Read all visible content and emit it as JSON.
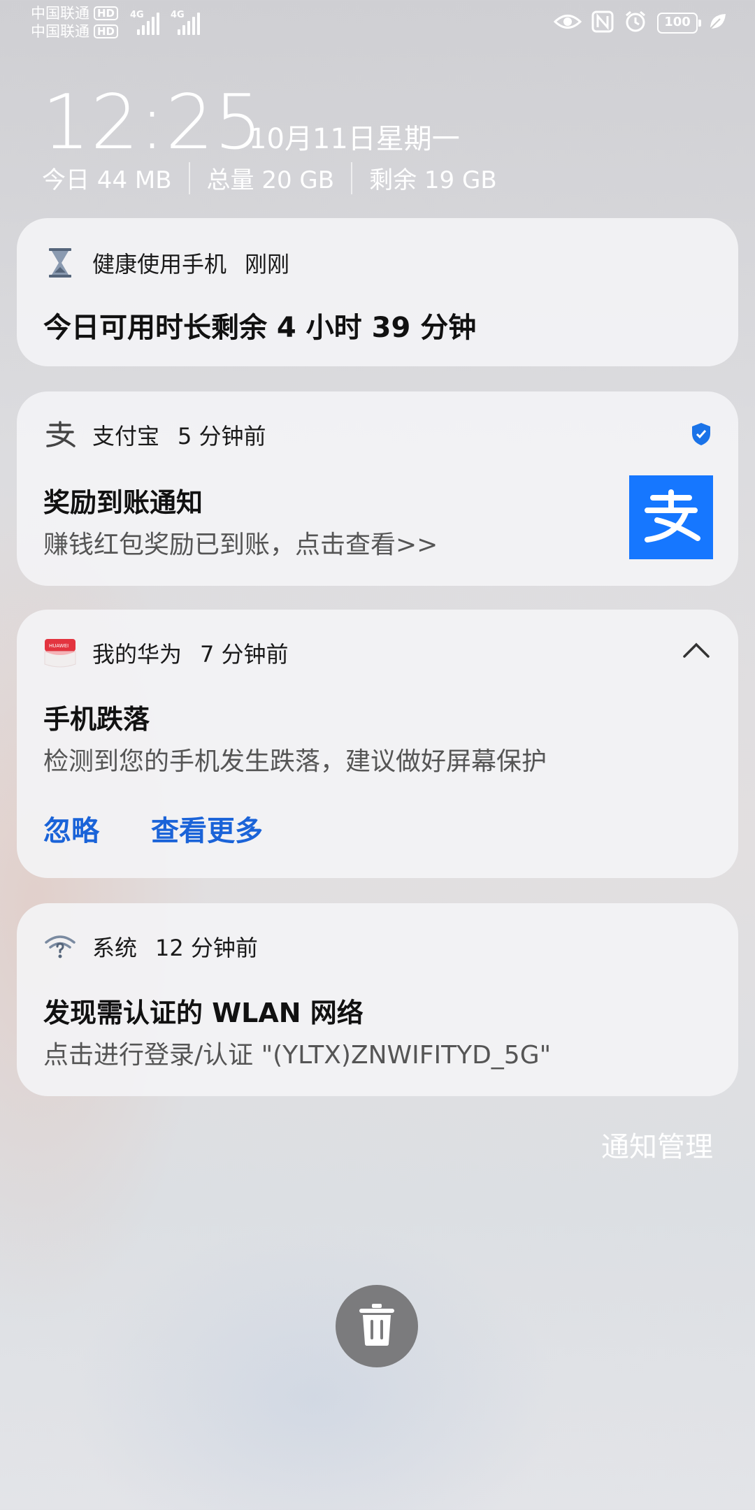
{
  "status_bar": {
    "carrier1": "中国联通",
    "carrier2": "中国联通",
    "hd_label": "HD",
    "network1": "4G",
    "network2": "4G",
    "battery_level": "100",
    "icons": [
      "eye-icon",
      "nfc-icon",
      "alarm-icon",
      "battery-icon",
      "leaf-icon"
    ]
  },
  "clock": {
    "time": "12:25",
    "date": "10月11日星期一"
  },
  "data_usage": {
    "today": "今日 44 MB",
    "total": "总量 20 GB",
    "remaining": "剩余 19 GB"
  },
  "notifications": [
    {
      "app": "健康使用手机",
      "time": "刚刚",
      "body": "今日可用时长剩余 4 小时 39 分钟",
      "icon": "hourglass-icon"
    },
    {
      "app": "支付宝",
      "time": "5 分钟前",
      "title": "奖励到账通知",
      "text": "赚钱红包奖励已到账，点击查看>>",
      "icon": "alipay-icon",
      "thumb_char": "支",
      "color": "#1677ff"
    },
    {
      "app": "我的华为",
      "time": "7 分钟前",
      "title": "手机跌落",
      "text": "检测到您的手机发生跌落，建议做好屏幕保护",
      "actions": [
        "忽略",
        "查看更多"
      ],
      "icon": "huawei-icon",
      "badge_text": "HUAWEI"
    },
    {
      "app": "系统",
      "time": "12 分钟前",
      "title": "发现需认证的 WLAN 网络",
      "text": "点击进行登录/认证 \"(YLTX)ZNWIFITYD_5G\"",
      "icon": "wifi-question-icon"
    }
  ],
  "manage_label": "通知管理",
  "clear_icon": "trash-icon"
}
